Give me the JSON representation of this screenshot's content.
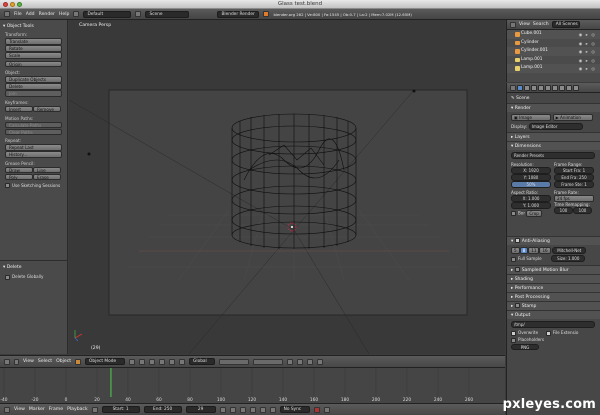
{
  "window": {
    "title": "Glass test.blend"
  },
  "info_header": {
    "menus": [
      "File",
      "Add",
      "Render",
      "Help"
    ],
    "screen_layout": "Default",
    "scene": "Scene",
    "engine": "Blender Render",
    "stats": "blender.org 262 | Ve:800 | Fa:1545 | Ob:0-7 | La:2 | Mem:7.02M (12.65M)"
  },
  "tool_shelf": {
    "title": "Object Tools",
    "transform_label": "Transform:",
    "translate": "Translate",
    "rotate": "Rotate",
    "scale": "Scale",
    "origin": "Origin",
    "object_label": "Object:",
    "duplicate": "Duplicate Objects",
    "delete": "Delete",
    "join": "Join",
    "keyframes_label": "Keyframes:",
    "insert": "Insert",
    "remove": "Remove",
    "motion_paths_label": "Motion Paths:",
    "calc_paths": "Calculate Paths",
    "clear_paths": "Clear Paths",
    "repeat_label": "Repeat:",
    "repeat_last": "Repeat Last",
    "history": "History...",
    "grease_pencil_label": "Grease Pencil:",
    "draw": "Draw",
    "line": "Line",
    "poly": "Poly",
    "erase": "Erase",
    "use_sketching": "Use Sketching Sessions",
    "op_panel_title": "Delete",
    "delete_globally": "Delete Globally"
  },
  "viewport": {
    "camera_label": "Camera Persp",
    "object_label": "(29)"
  },
  "viewport_header": {
    "menus": [
      "View",
      "Select",
      "Object"
    ],
    "mode": "Object Mode",
    "pivot": "Global"
  },
  "timeline": {
    "ticks": [
      "-40",
      "-20",
      "0",
      "20",
      "40",
      "60",
      "80",
      "100",
      "120",
      "140",
      "160",
      "180",
      "200",
      "220",
      "240",
      "260"
    ],
    "current_frame_marker": 29
  },
  "timeline_header": {
    "menus": [
      "View",
      "Marker",
      "Frame",
      "Playback"
    ],
    "start": "Start: 1",
    "end": "End: 250",
    "current": "29",
    "sync": "No Sync"
  },
  "outliner": {
    "menus": [
      "View",
      "Search"
    ],
    "filter": "All Scenes",
    "items": [
      "Cube.001",
      "Cylinder",
      "Cylinder.001",
      "Lamp.001",
      "Lamp.001"
    ]
  },
  "properties": {
    "breadcrumb": "Scene",
    "render_section": "Render",
    "image_btn": "Image",
    "animation_btn": "Animation",
    "display_label": "Display:",
    "display_value": "Image Editor",
    "layers_section": "Layers",
    "dimensions_section": "Dimensions",
    "render_presets": "Render Presets",
    "resolution_label": "Resolution:",
    "res_x": "X: 1920",
    "res_y": "Y: 1080",
    "res_pct": "50%",
    "frame_range_label": "Frame Range:",
    "start_frame": "Start Fra: 1",
    "end_frame": "End Fra: 250",
    "frame_step": "Frame Ste: 1",
    "aspect_label": "Aspect Ratio:",
    "asp_x": "X: 1.000",
    "asp_y": "Y: 1.000",
    "frame_rate_label": "Frame Rate:",
    "fps": "24 fps",
    "time_remap_label": "Time Remapping:",
    "remap_old": "100",
    "remap_new": "100",
    "border": "Bor",
    "crop": "Crop",
    "aa_section": "Anti-Aliasing",
    "aa_samples": [
      "5",
      "8",
      "11",
      "16"
    ],
    "aa_filter": "Mitchell-Net",
    "full_sample": "Full Sample",
    "aa_size": "Size: 1.000",
    "motion_blur_section": "Sampled Motion Blur",
    "shading_section": "Shading",
    "performance_section": "Performance",
    "post_processing_section": "Post Processing",
    "stamp_section": "Stamp",
    "output_section": "Output",
    "output_path": "/tmp/",
    "overwrite": "Overwrite",
    "file_ext": "File Extensio",
    "placeholders": "Placeholders",
    "format": "PNG"
  },
  "watermark": "pxleyes.com"
}
